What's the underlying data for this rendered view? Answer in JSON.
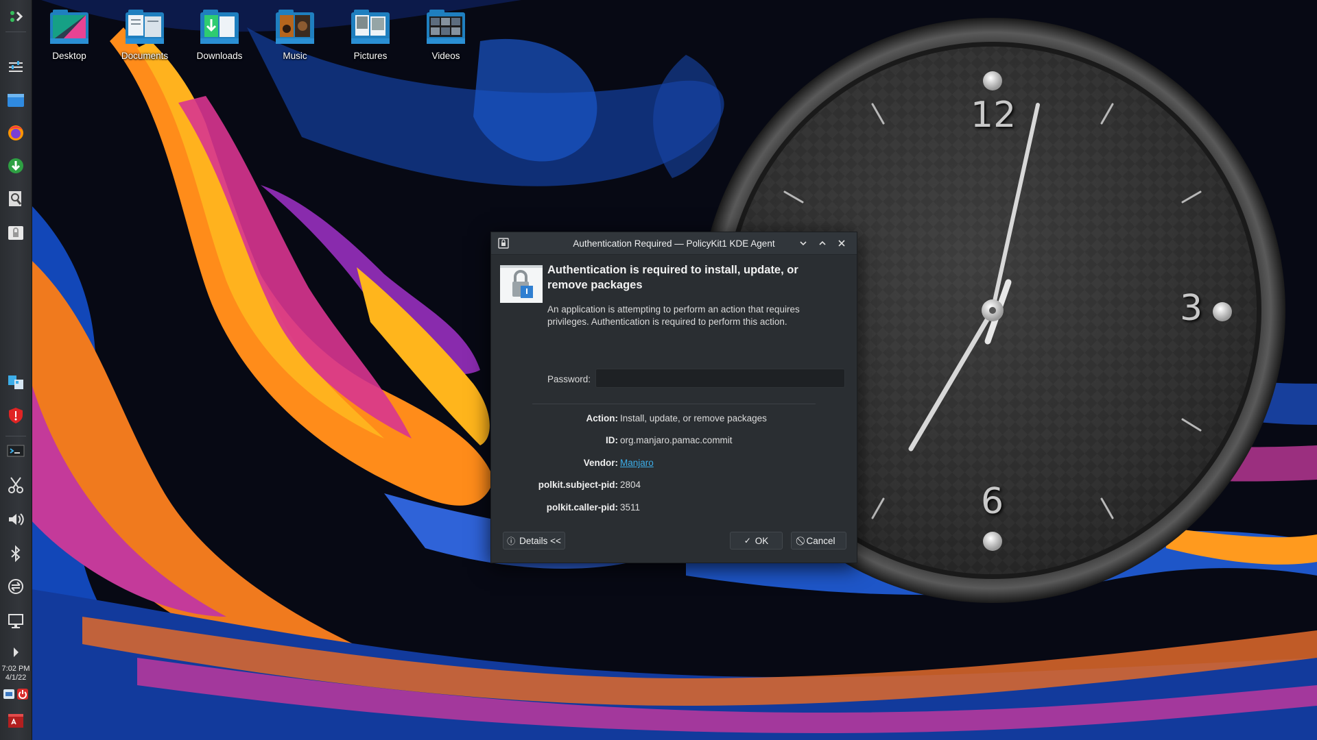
{
  "desktop": {
    "icons": [
      {
        "label": "Desktop"
      },
      {
        "label": "Documents"
      },
      {
        "label": "Downloads"
      },
      {
        "label": "Music"
      },
      {
        "label": "Pictures"
      },
      {
        "label": "Videos"
      }
    ]
  },
  "clock_widget": {
    "numerals": {
      "twelve": "12",
      "three": "3",
      "six": "6"
    },
    "hour_hand_angle_deg": 210,
    "minute_hand_angle_deg": 12
  },
  "panel": {
    "time": "7:02 PM",
    "date": "4/1/22",
    "icons": [
      "application-launcher-icon",
      "settings-icon",
      "file-manager-icon",
      "firefox-icon",
      "software-update-icon",
      "search-icon",
      "lock-icon",
      "kde-connect-icon",
      "security-shield-icon",
      "terminal-icon",
      "scissors-icon",
      "volume-icon",
      "bluetooth-icon",
      "network-icon",
      "display-icon",
      "expand-arrow-icon",
      "tray-icon",
      "power-icon",
      "text-editor-icon"
    ]
  },
  "dialog": {
    "title": "Authentication Required — PolicyKit1 KDE Agent",
    "heading": "Authentication is required to install, update, or remove packages",
    "description": "An application is attempting to perform an action that requires privileges. Authentication is required to perform this action.",
    "password_label": "Password:",
    "password_value": "",
    "details": [
      {
        "key": "Action:",
        "value": "Install, update, or remove packages",
        "link": false
      },
      {
        "key": "ID:",
        "value": "org.manjaro.pamac.commit",
        "link": false
      },
      {
        "key": "Vendor:",
        "value": "Manjaro",
        "link": true
      },
      {
        "key": "polkit.subject-pid:",
        "value": "2804",
        "link": false
      },
      {
        "key": "polkit.caller-pid:",
        "value": "3511",
        "link": false
      }
    ],
    "details_button": "Details <<",
    "ok_button": "OK",
    "cancel_button": "Cancel",
    "accent_color": "#3daee9"
  }
}
